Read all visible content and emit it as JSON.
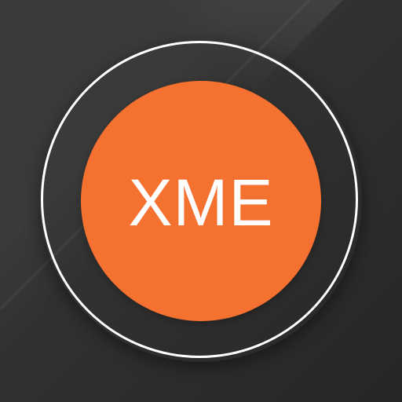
{
  "icon": {
    "label": "XME",
    "colors": {
      "background": "#2f2f2f",
      "accent": "#f57130",
      "ring": "#ffffff",
      "text": "#ffffff"
    }
  }
}
